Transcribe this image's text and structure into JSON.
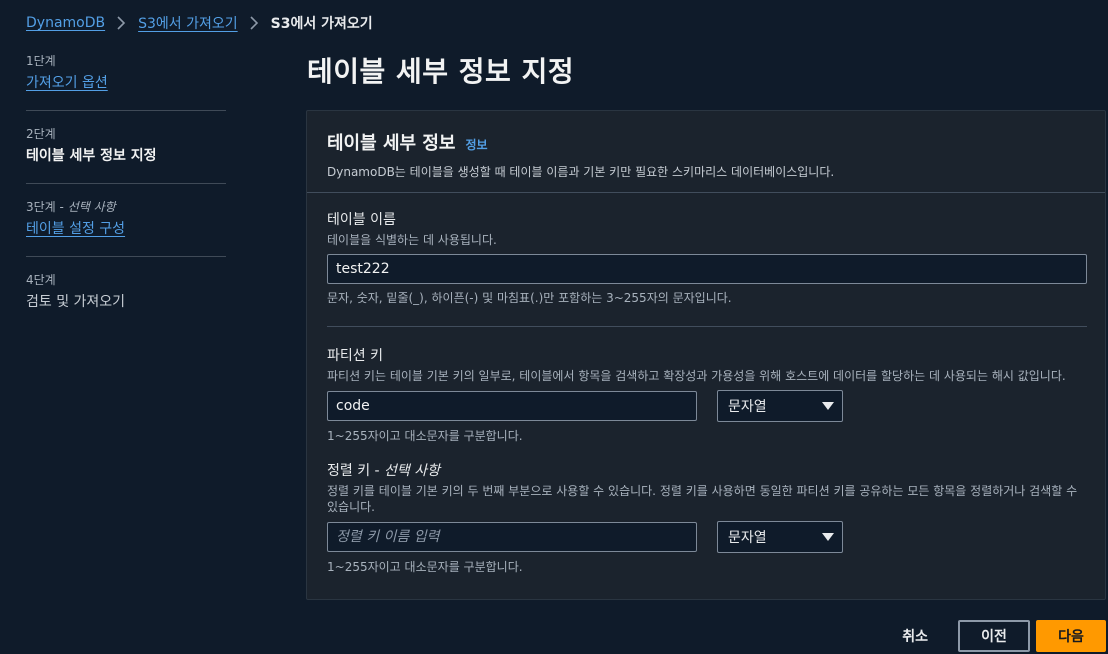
{
  "breadcrumb": {
    "items": [
      "DynamoDB",
      "S3에서 가져오기"
    ],
    "current": "S3에서 가져오기"
  },
  "steps": [
    {
      "number": "1단계",
      "label": "가져오기 옵션",
      "state": "link"
    },
    {
      "number": "2단계",
      "label": "테이블 세부 정보 지정",
      "state": "active"
    },
    {
      "number": "3단계",
      "optional": "선택 사항",
      "label": "테이블 설정 구성",
      "state": "link"
    },
    {
      "number": "4단계",
      "label": "검토 및 가져오기",
      "state": "disabled"
    }
  ],
  "page_title": "테이블 세부 정보 지정",
  "container": {
    "title": "테이블 세부 정보",
    "info": "정보",
    "description": "DynamoDB는 테이블을 생성할 때 테이블 이름과 기본 키만 필요한 스키마리스 데이터베이스입니다."
  },
  "table_name": {
    "label": "테이블 이름",
    "description": "테이블을 식별하는 데 사용됩니다.",
    "value": "test222",
    "hint": "문자, 숫자, 밑줄(_), 하이픈(-) 및 마침표(.)만 포함하는 3~255자의 문자입니다."
  },
  "partition_key": {
    "label": "파티션 키",
    "description": "파티션 키는 테이블 기본 키의 일부로, 테이블에서 항목을 검색하고 확장성과 가용성을 위해 호스트에 데이터를 할당하는 데 사용되는 해시 값입니다.",
    "value": "code",
    "type": "문자열",
    "hint": "1~255자이고 대소문자를 구분합니다."
  },
  "sort_key": {
    "label": "정렬 키",
    "optional": "선택 사항",
    "description": "정렬 키를 테이블 기본 키의 두 번째 부분으로 사용할 수 있습니다. 정렬 키를 사용하면 동일한 파티션 키를 공유하는 모든 항목을 정렬하거나 검색할 수 있습니다.",
    "placeholder": "정렬 키 이름 입력",
    "value": "",
    "type": "문자열",
    "hint": "1~255자이고 대소문자를 구분합니다."
  },
  "footer": {
    "cancel": "취소",
    "previous": "이전",
    "next": "다음"
  },
  "colors": {
    "background": "#0f1b2a",
    "link": "#539fe5",
    "primary": "#ff9900"
  }
}
